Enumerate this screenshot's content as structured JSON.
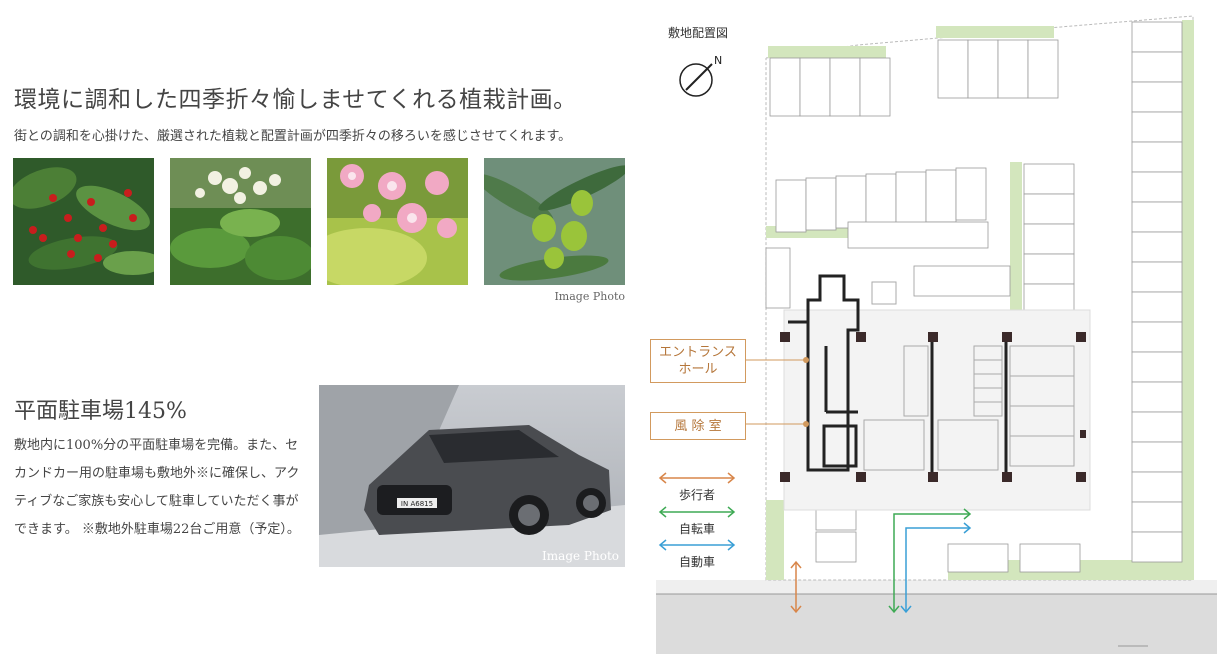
{
  "landscaping": {
    "heading": "環境に調和した四季折々愉しませてくれる植栽計画。",
    "description": "街との調和を心掛けた、厳選された植栽と配置計画が四季折々の移ろいを感じさせてくれます。",
    "caption": "Image Photo"
  },
  "parking": {
    "heading": "平面駐車場145%",
    "description": "敷地内に100%分の平面駐車場を完備。また、セカンドカー用の駐車場も敷地外※に確保し、アクティブなご家族も安心して駐車していただく事ができます。 ※敷地外駐車場22台ご用意（予定）。",
    "caption": "Image Photo",
    "plate": "IN A6815"
  },
  "site_plan": {
    "title": "敷地配置図",
    "compass": "N",
    "entrance_hall_line1": "エントランス",
    "entrance_hall_line2": "ホール",
    "windbreak_room": "風 除 室",
    "legend": {
      "pedestrian": "歩行者",
      "bicycle": "自転車",
      "car": "自動車"
    },
    "colors": {
      "pedestrian": "#d8864a",
      "bicycle": "#3faa55",
      "car": "#3a9fd6",
      "green_strip": "#cfe3b8",
      "wall": "#222222"
    }
  }
}
